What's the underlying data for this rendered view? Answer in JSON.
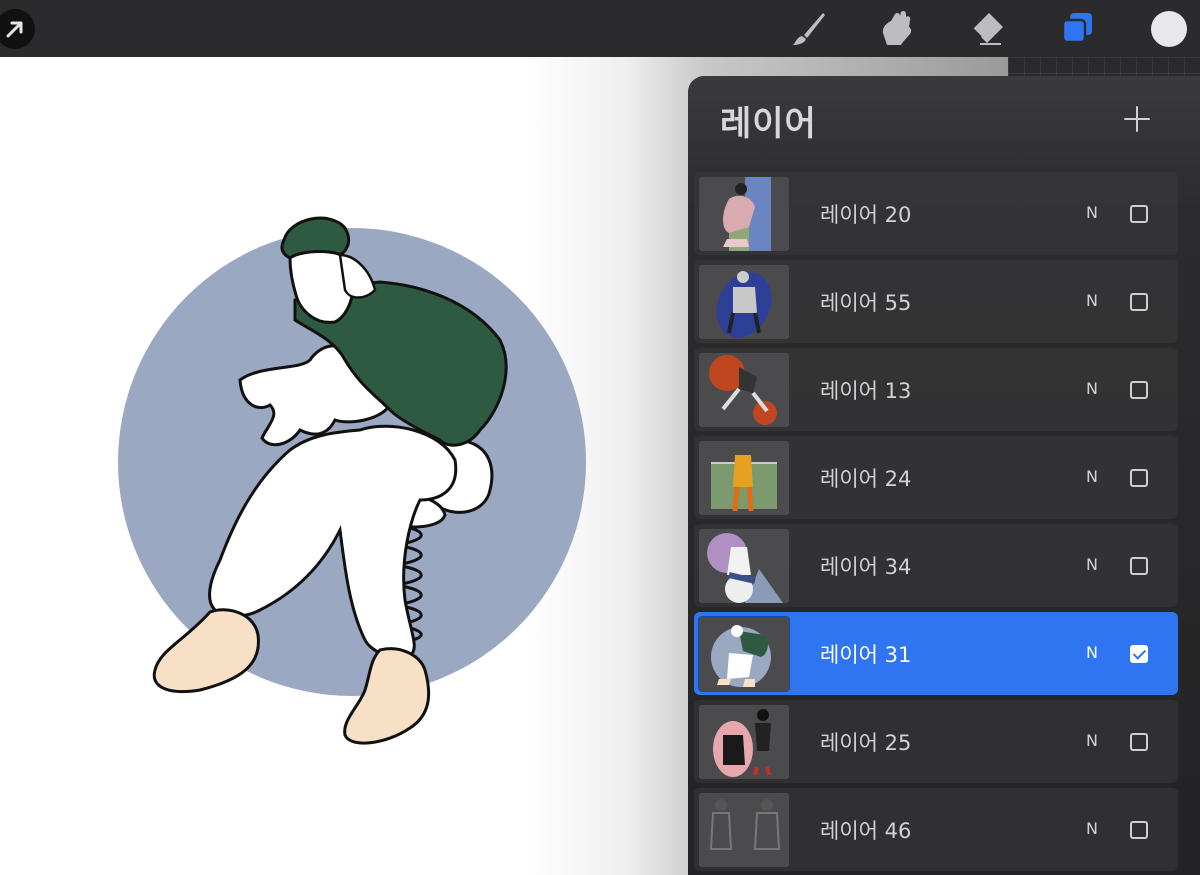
{
  "toolbar": {
    "modify_icon": "arrow-cursor-icon",
    "tools": [
      "brush-icon",
      "smudge-icon",
      "eraser-icon",
      "layers-icon"
    ],
    "active_tool": "layers-icon",
    "color_swatch": "#e8e8ea"
  },
  "panel": {
    "title": "레이어",
    "add_icon": "plus-icon",
    "layers": [
      {
        "name": "레이어 20",
        "blend": "N",
        "visible": false
      },
      {
        "name": "레이어 55",
        "blend": "N",
        "visible": false
      },
      {
        "name": "레이어 13",
        "blend": "N",
        "visible": false
      },
      {
        "name": "레이어 24",
        "blend": "N",
        "visible": false
      },
      {
        "name": "레이어 34",
        "blend": "N",
        "visible": false
      },
      {
        "name": "레이어 31",
        "blend": "N",
        "visible": true
      },
      {
        "name": "레이어 25",
        "blend": "N",
        "visible": false
      },
      {
        "name": "레이어 46",
        "blend": "N",
        "visible": false
      }
    ],
    "selected_index": 5
  },
  "colors": {
    "accent": "#2f74f0",
    "circle": "#9aa8c2",
    "jacket": "#2f5a42",
    "shoes": "#f7e0c6"
  }
}
